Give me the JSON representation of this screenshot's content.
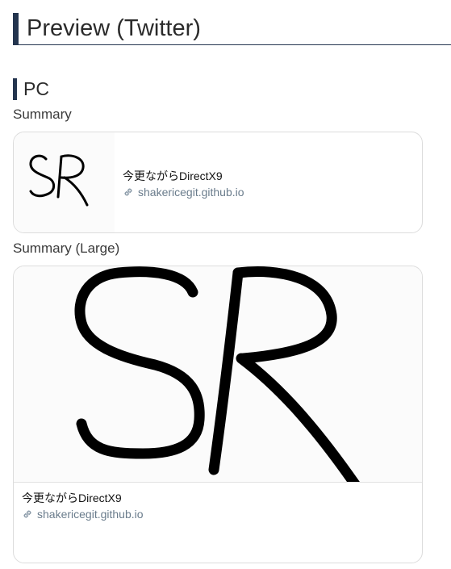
{
  "heading": {
    "title": "Preview (Twitter)"
  },
  "section": {
    "title": "PC"
  },
  "summary": {
    "label": "Summary",
    "card": {
      "title": "今更ながらDirectX9",
      "domain": "shakericegit.github.io",
      "image_icon": "sr-handwritten-logo"
    }
  },
  "summary_large": {
    "label": "Summary (Large)",
    "card": {
      "title": "今更ながらDirectX9",
      "domain": "shakericegit.github.io",
      "image_icon": "sr-handwritten-logo"
    }
  },
  "icons": {
    "link": "link-icon"
  },
  "colors": {
    "accent": "#24354f",
    "domain_text": "#6a7c8c",
    "card_border": "#dcdcdc"
  }
}
